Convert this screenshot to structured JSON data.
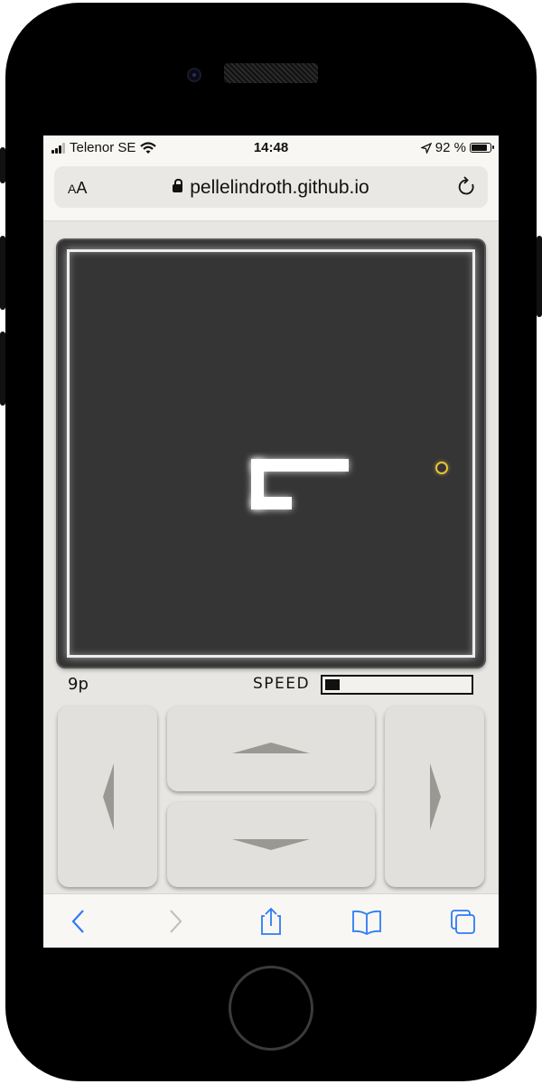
{
  "status_bar": {
    "carrier": "Telenor SE",
    "time": "14:48",
    "battery_percent": "92 %",
    "battery_level": 0.92
  },
  "browser": {
    "text_size_label_small": "A",
    "text_size_label_large": "A",
    "url": "pellelindroth.github.io"
  },
  "game": {
    "score": "9p",
    "speed_label": "SPEED",
    "speed_level": 0.1
  },
  "controls": {
    "left": "left-arrow-icon",
    "up": "up-arrow-icon",
    "down": "down-arrow-icon",
    "right": "right-arrow-icon"
  },
  "toolbar": {
    "back": "chevron-left-icon",
    "forward": "chevron-right-icon",
    "share": "share-icon",
    "bookmarks": "book-icon",
    "tabs": "tabs-icon"
  },
  "colors": {
    "accent": "#2f7bf5",
    "board": "#353535",
    "food": "#e7c23a",
    "snake": "#ffffff"
  }
}
